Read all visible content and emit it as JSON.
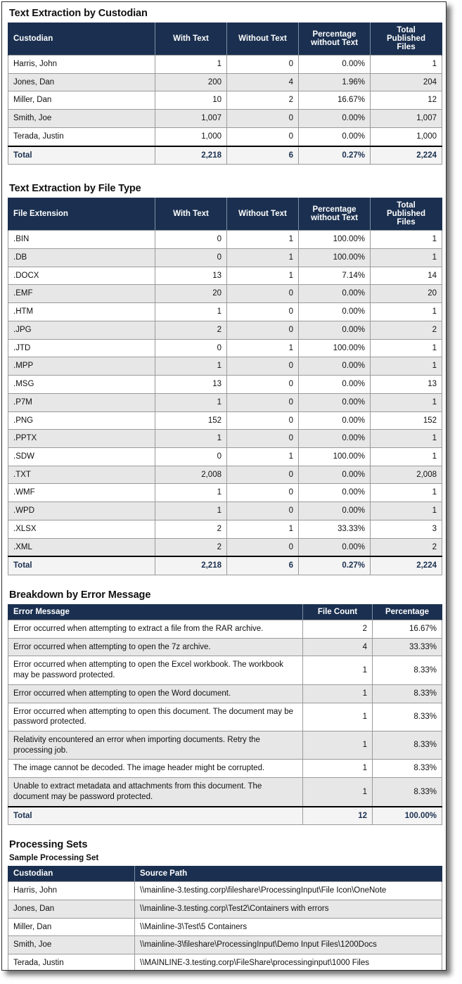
{
  "sections": {
    "custodian": {
      "title": "Text Extraction by Custodian",
      "columns": [
        "Custodian",
        "With Text",
        "Without Text",
        "Percentage without Text",
        "Total Published Files"
      ],
      "columns_wrapped": [
        [
          "Custodian"
        ],
        [
          "With Text"
        ],
        [
          "Without Text"
        ],
        [
          "Percentage",
          "without Text"
        ],
        [
          "Total",
          "Published",
          "Files"
        ]
      ],
      "rows": [
        {
          "name": "Harris, John",
          "with_text": "1",
          "without_text": "0",
          "pct": "0.00%",
          "total": "1"
        },
        {
          "name": "Jones, Dan",
          "with_text": "200",
          "without_text": "4",
          "pct": "1.96%",
          "total": "204"
        },
        {
          "name": "Miller, Dan",
          "with_text": "10",
          "without_text": "2",
          "pct": "16.67%",
          "total": "12"
        },
        {
          "name": "Smith, Joe",
          "with_text": "1,007",
          "without_text": "0",
          "pct": "0.00%",
          "total": "1,007"
        },
        {
          "name": "Terada, Justin",
          "with_text": "1,000",
          "without_text": "0",
          "pct": "0.00%",
          "total": "1,000"
        }
      ],
      "total": {
        "name": "Total",
        "with_text": "2,218",
        "without_text": "6",
        "pct": "0.27%",
        "total": "2,224"
      }
    },
    "filetype": {
      "title": "Text Extraction by File Type",
      "columns": [
        "File Extension",
        "With Text",
        "Without Text",
        "Percentage without Text",
        "Total Published Files"
      ],
      "columns_wrapped": [
        [
          "File Extension"
        ],
        [
          "With Text"
        ],
        [
          "Without Text"
        ],
        [
          "Percentage",
          "without Text"
        ],
        [
          "Total",
          "Published",
          "Files"
        ]
      ],
      "rows": [
        {
          "name": ".BIN",
          "with_text": "0",
          "without_text": "1",
          "pct": "100.00%",
          "total": "1"
        },
        {
          "name": ".DB",
          "with_text": "0",
          "without_text": "1",
          "pct": "100.00%",
          "total": "1"
        },
        {
          "name": ".DOCX",
          "with_text": "13",
          "without_text": "1",
          "pct": "7.14%",
          "total": "14"
        },
        {
          "name": ".EMF",
          "with_text": "20",
          "without_text": "0",
          "pct": "0.00%",
          "total": "20"
        },
        {
          "name": ".HTM",
          "with_text": "1",
          "without_text": "0",
          "pct": "0.00%",
          "total": "1"
        },
        {
          "name": ".JPG",
          "with_text": "2",
          "without_text": "0",
          "pct": "0.00%",
          "total": "2"
        },
        {
          "name": ".JTD",
          "with_text": "0",
          "without_text": "1",
          "pct": "100.00%",
          "total": "1"
        },
        {
          "name": ".MPP",
          "with_text": "1",
          "without_text": "0",
          "pct": "0.00%",
          "total": "1"
        },
        {
          "name": ".MSG",
          "with_text": "13",
          "without_text": "0",
          "pct": "0.00%",
          "total": "13"
        },
        {
          "name": ".P7M",
          "with_text": "1",
          "without_text": "0",
          "pct": "0.00%",
          "total": "1"
        },
        {
          "name": ".PNG",
          "with_text": "152",
          "without_text": "0",
          "pct": "0.00%",
          "total": "152"
        },
        {
          "name": ".PPTX",
          "with_text": "1",
          "without_text": "0",
          "pct": "0.00%",
          "total": "1"
        },
        {
          "name": ".SDW",
          "with_text": "0",
          "without_text": "1",
          "pct": "100.00%",
          "total": "1"
        },
        {
          "name": ".TXT",
          "with_text": "2,008",
          "without_text": "0",
          "pct": "0.00%",
          "total": "2,008"
        },
        {
          "name": ".WMF",
          "with_text": "1",
          "without_text": "0",
          "pct": "0.00%",
          "total": "1"
        },
        {
          "name": ".WPD",
          "with_text": "1",
          "without_text": "0",
          "pct": "0.00%",
          "total": "1"
        },
        {
          "name": ".XLSX",
          "with_text": "2",
          "without_text": "1",
          "pct": "33.33%",
          "total": "3"
        },
        {
          "name": ".XML",
          "with_text": "2",
          "without_text": "0",
          "pct": "0.00%",
          "total": "2"
        }
      ],
      "total": {
        "name": "Total",
        "with_text": "2,218",
        "without_text": "6",
        "pct": "0.27%",
        "total": "2,224"
      }
    },
    "errors": {
      "title": "Breakdown by Error Message",
      "columns": [
        "Error Message",
        "File Count",
        "Percentage"
      ],
      "rows": [
        {
          "message": "Error occurred when attempting to extract a file from the RAR archive.",
          "count": "2",
          "pct": "16.67%"
        },
        {
          "message": "Error occurred when attempting to open the 7z archive.",
          "count": "4",
          "pct": "33.33%"
        },
        {
          "message": "Error occurred when attempting to open the Excel workbook. The workbook may be password protected.",
          "count": "1",
          "pct": "8.33%"
        },
        {
          "message": "Error occurred when attempting to open the Word document.",
          "count": "1",
          "pct": "8.33%"
        },
        {
          "message": "Error occurred when attempting to open this document. The document may be password protected.",
          "count": "1",
          "pct": "8.33%"
        },
        {
          "message": "Relativity encountered an error when importing documents. Retry the processing job.",
          "count": "1",
          "pct": "8.33%"
        },
        {
          "message": "The image cannot be decoded. The image header might be corrupted.",
          "count": "1",
          "pct": "8.33%"
        },
        {
          "message": "Unable to extract metadata and attachments from this document. The document may be password protected.",
          "count": "1",
          "pct": "8.33%"
        }
      ],
      "total": {
        "label": "Total",
        "count": "12",
        "pct": "100.00%"
      }
    },
    "processing_sets": {
      "title": "Processing Sets",
      "set_name": "Sample Processing Set",
      "columns": [
        "Custodian",
        "Source Path"
      ],
      "rows": [
        {
          "custodian": "Harris, John",
          "source_path": "\\\\mainline-3.testing.corp\\fileshare\\ProcessingInput\\File Icon\\OneNote"
        },
        {
          "custodian": "Jones, Dan",
          "source_path": "\\\\mainline-3.testing.corp\\Test2\\Containers with errors"
        },
        {
          "custodian": "Miller, Dan",
          "source_path": "\\\\Mainline-3\\Test\\5 Containers"
        },
        {
          "custodian": "Smith, Joe",
          "source_path": "\\\\mainline-3\\fileshare\\ProcessingInput\\Demo Input Files\\1200Docs"
        },
        {
          "custodian": "Terada, Justin",
          "source_path": "\\\\MAINLINE-3.testing.corp\\FileShare\\processinginput\\1000 Files"
        }
      ]
    }
  },
  "colors": {
    "header_navy": "#1b3050",
    "row_alt": "#e7e7e7",
    "total_bg": "#f4f4f4",
    "border": "#9a9a9a"
  }
}
